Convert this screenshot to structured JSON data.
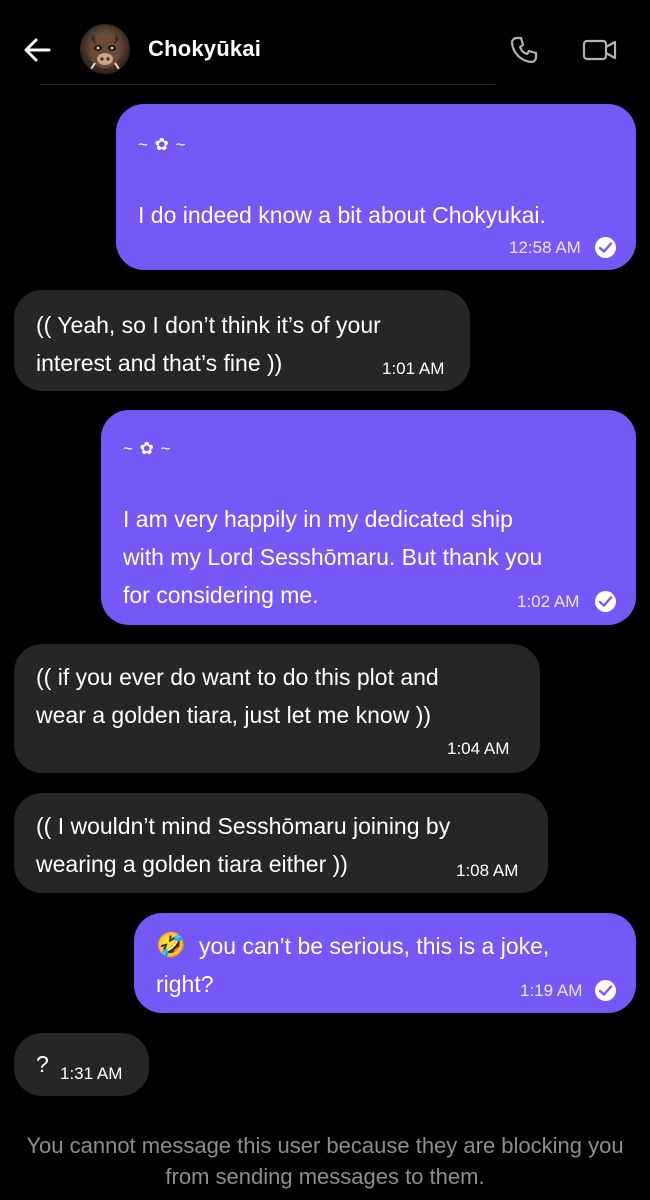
{
  "header": {
    "contact_name": "Chokyūkai",
    "back_icon": "arrow-left-icon",
    "call_icon": "phone-icon",
    "video_icon": "video-camera-icon"
  },
  "messages": [
    {
      "direction": "outgoing",
      "decoration": "~ ✿ ~",
      "text": "I do indeed know a bit about Chokyukai.",
      "time": "12:58 AM",
      "read": true
    },
    {
      "direction": "incoming",
      "text": "(( Yeah, so I don’t think it’s of your\ninterest and that’s fine ))",
      "time": "1:01 AM"
    },
    {
      "direction": "outgoing",
      "decoration": "~ ✿ ~",
      "text": "I am very happily in my dedicated ship\nwith my Lord Sesshōmaru. But thank you\nfor considering me.",
      "time": "1:02 AM",
      "read": true
    },
    {
      "direction": "incoming",
      "text": "(( if you ever do want to do this plot and\nwear a golden tiara, just let me know ))",
      "time": "1:04 AM"
    },
    {
      "direction": "incoming",
      "text": "(( I wouldn’t mind Sesshōmaru joining by\nwearing a golden tiara either ))",
      "time": "1:08 AM"
    },
    {
      "direction": "outgoing",
      "emoji": "🤣",
      "text": "you can’t be serious, this is a joke,\nright?",
      "time": "1:19 AM",
      "read": true
    },
    {
      "direction": "incoming",
      "text": "?",
      "time": "1:31 AM"
    }
  ],
  "footer": {
    "blocked_notice": "You cannot message this user because they are blocking you from sending messages to them."
  },
  "colors": {
    "background": "#000000",
    "outgoing_bubble": "#7459f7",
    "incoming_bubble": "#262626",
    "muted_text": "#8e8e8e"
  }
}
